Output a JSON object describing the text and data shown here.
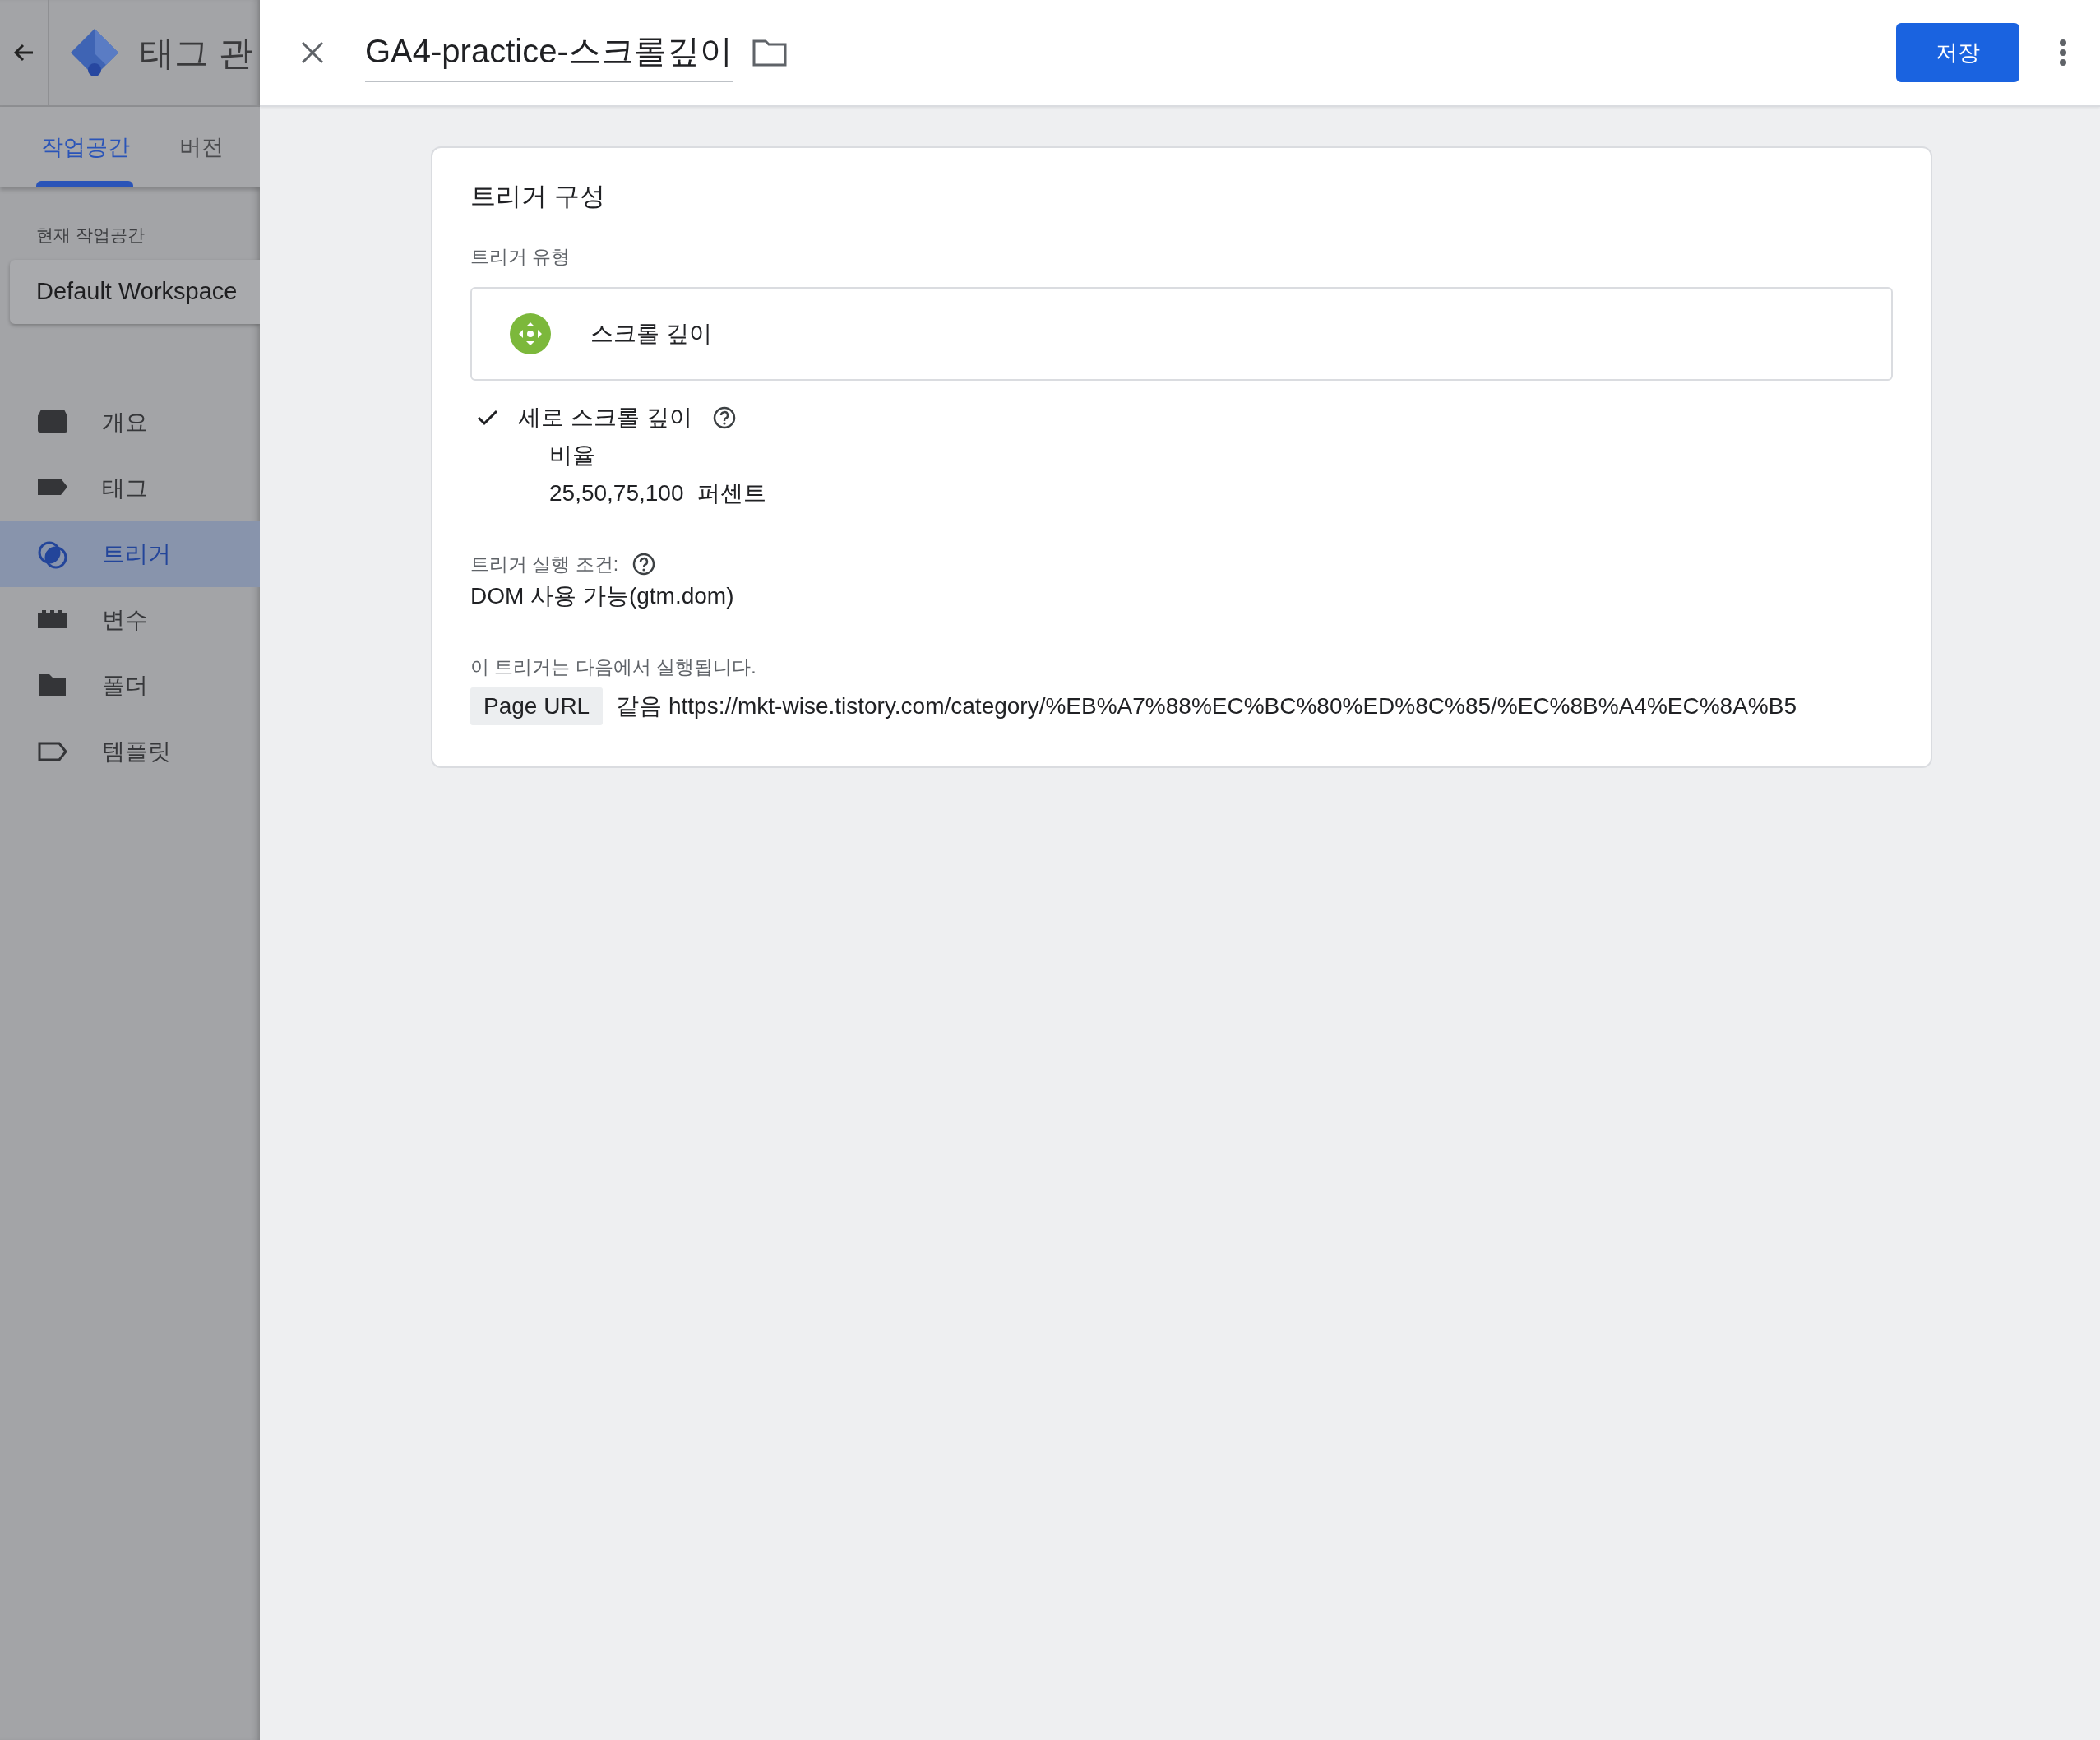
{
  "app": {
    "title": "태그 관"
  },
  "sidebar": {
    "tabs": [
      {
        "label": "작업공간",
        "selected": true
      },
      {
        "label": "버전",
        "selected": false
      }
    ],
    "workspace_label": "현재 작업공간",
    "workspace": "Default Workspace",
    "items": [
      {
        "label": "개요",
        "kind": "overview",
        "selected": false
      },
      {
        "label": "태그",
        "kind": "tag",
        "selected": false
      },
      {
        "label": "트리거",
        "kind": "trigger",
        "selected": true
      },
      {
        "label": "변수",
        "kind": "variable",
        "selected": false
      },
      {
        "label": "폴더",
        "kind": "folder",
        "selected": false
      },
      {
        "label": "템플릿",
        "kind": "template",
        "selected": false
      }
    ]
  },
  "editor": {
    "title": "GA4-practice-스크롤깊이",
    "save_button": "저장"
  },
  "card": {
    "heading": "트리거 구성",
    "type_label": "트리거 유형",
    "trigger_type": "스크롤 깊이",
    "options": [
      {
        "label": "세로 스크롤 깊이",
        "checked": true,
        "detail_label": "비율",
        "values": "25,50,75,100",
        "unit": "퍼센트"
      }
    ],
    "fire_on_label": "트리거 실행 조건:",
    "fire_on": "DOM 사용 가능(gtm.dom)",
    "condition_label": "이 트리거는 다음에서 실행됩니다.",
    "condition": {
      "variable": "Page URL",
      "operator": "같음",
      "value": "https://mkt-wise.tistory.com/category/%EB%A7%88%EC%BC%80%ED%8C%85/%EC%8B%A4%EC%8A%B5"
    }
  }
}
